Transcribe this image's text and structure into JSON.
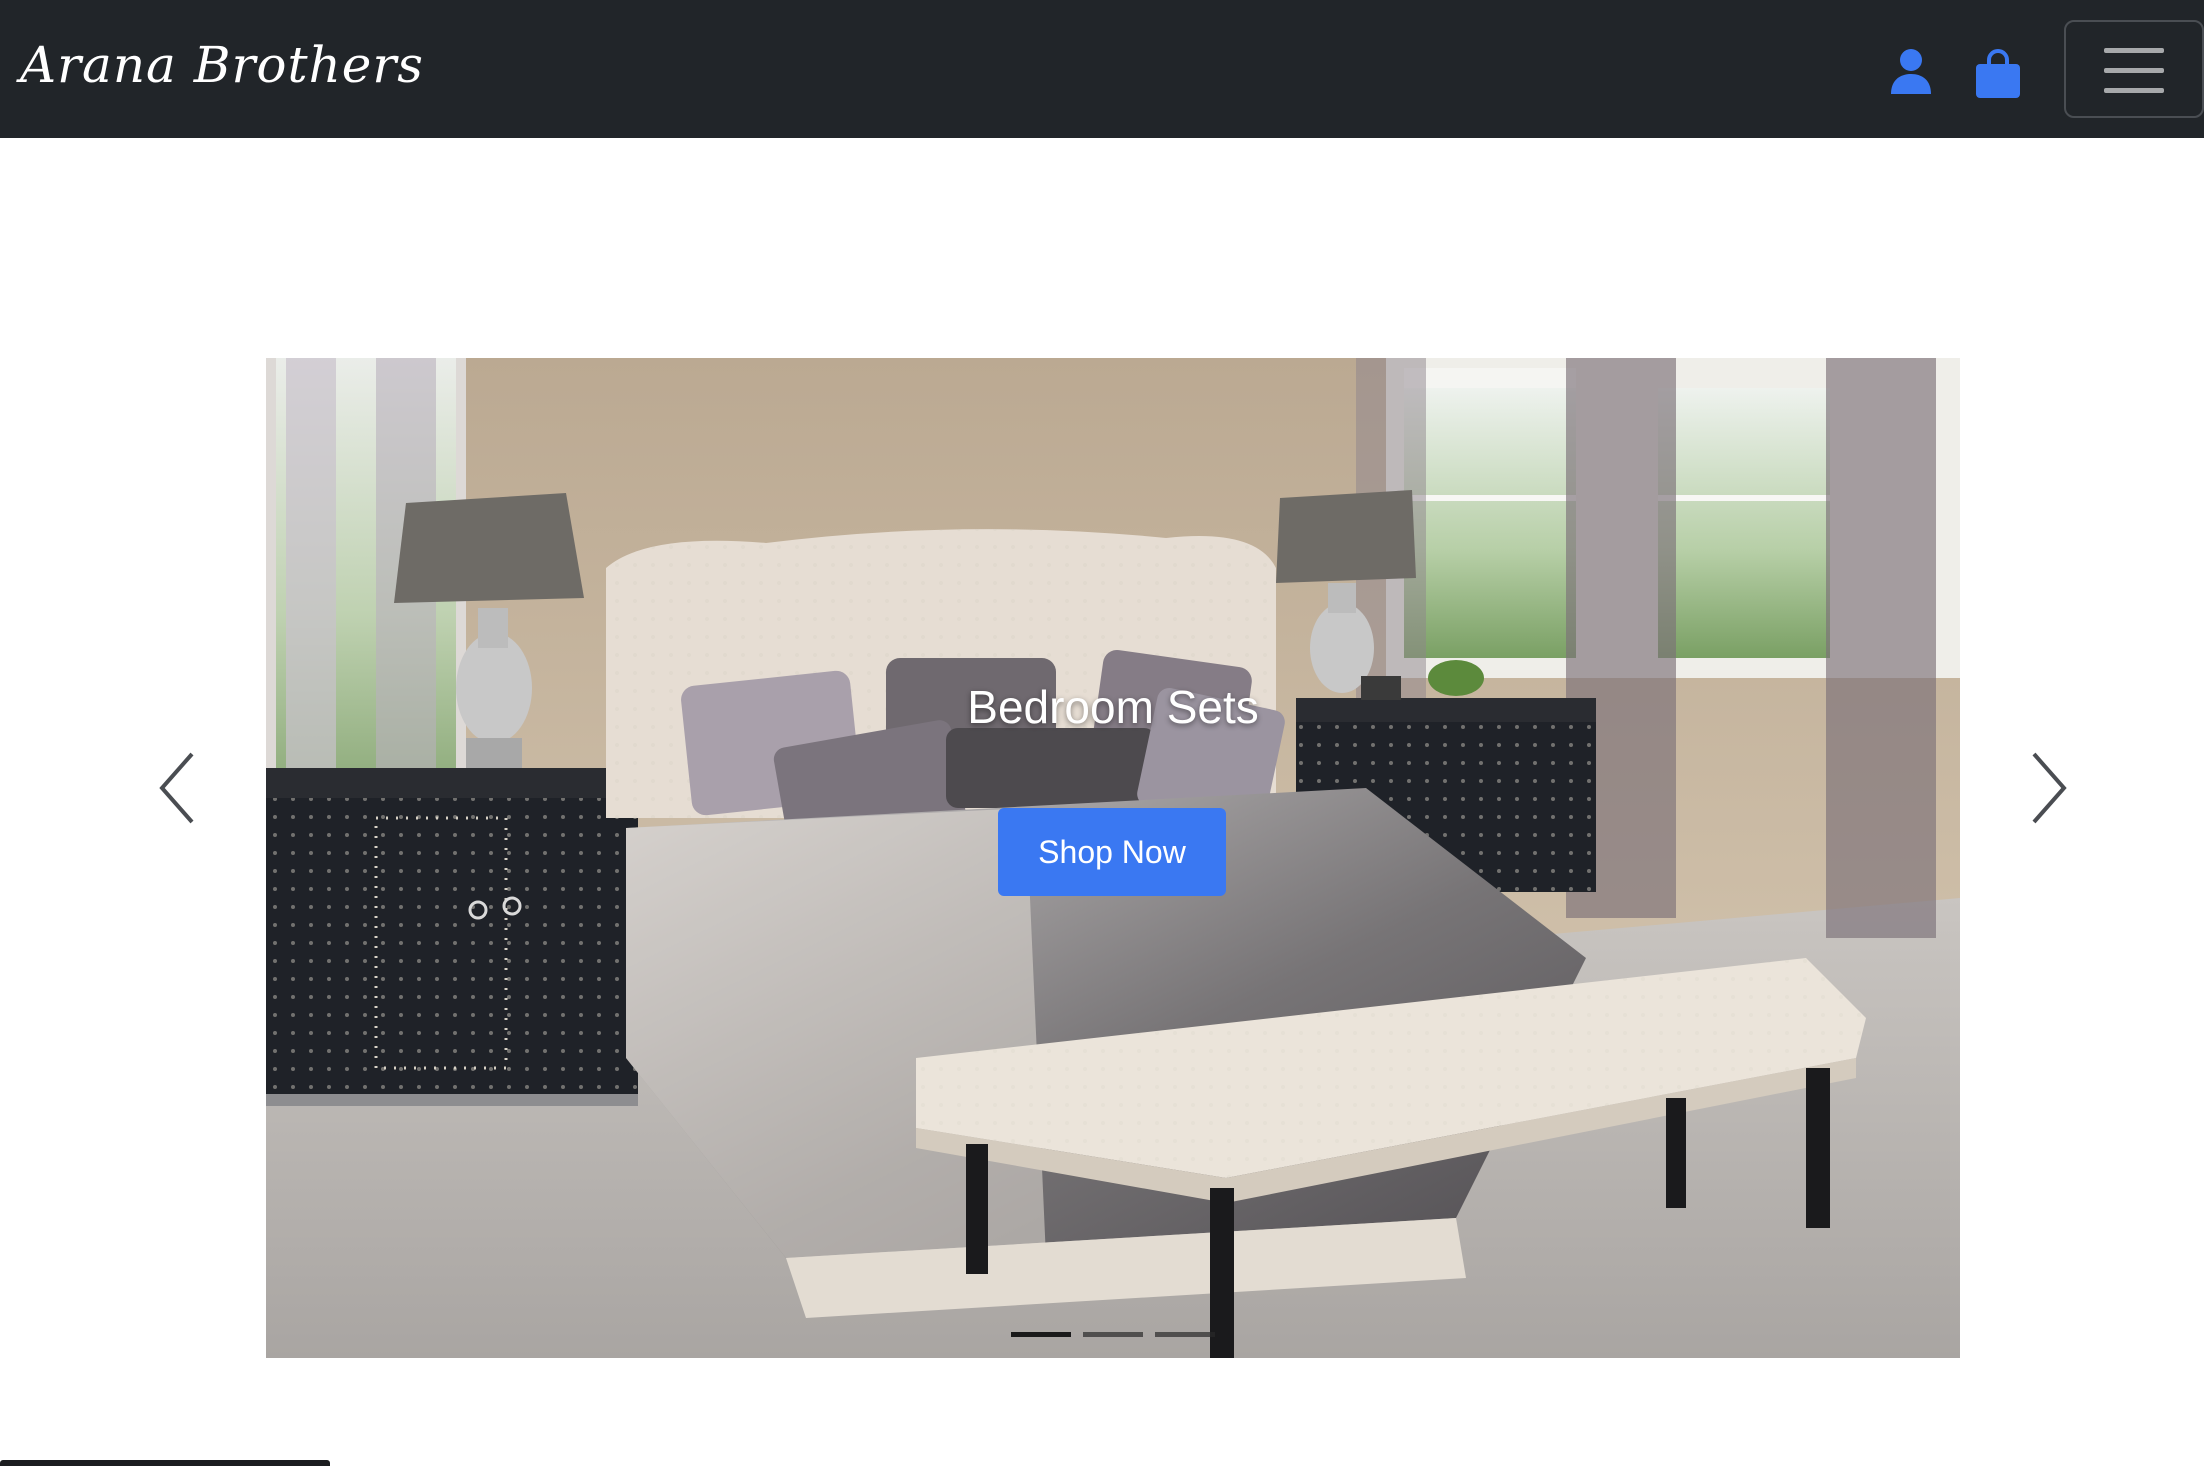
{
  "navbar": {
    "brand": "Arana Brothers",
    "icons": [
      "user-icon",
      "shopping-bag-icon",
      "hamburger-menu-icon"
    ],
    "icon_color": "#3a78f2",
    "background": "#212529"
  },
  "carousel": {
    "slides": [
      {
        "title": "Bedroom Sets",
        "button_label": "Shop Now"
      }
    ],
    "active_slide": 1,
    "slide_count": 3,
    "prev_icon": "chevron-left-icon",
    "next_icon": "chevron-right-icon",
    "button_color": "#3a78f2"
  }
}
